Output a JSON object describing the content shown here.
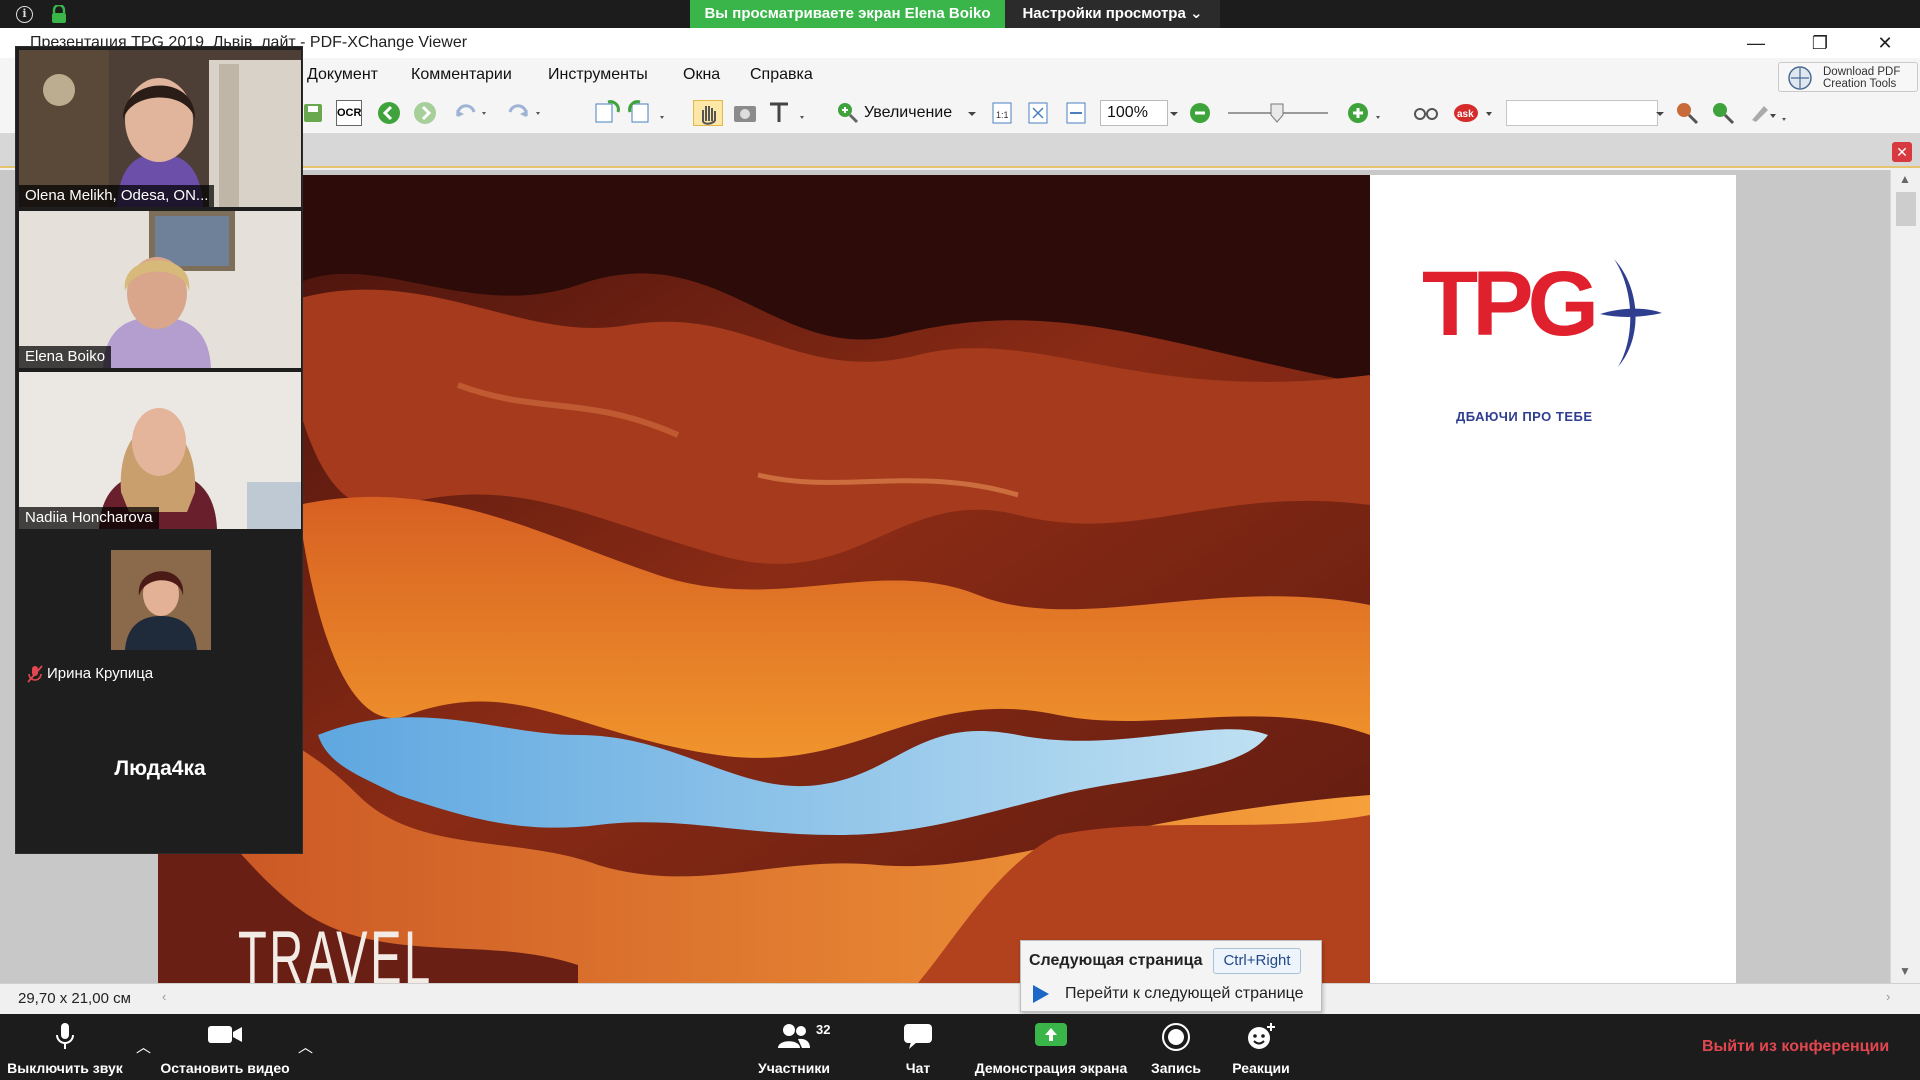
{
  "zoom_top": {
    "banner": "Вы просматриваете экран Elena Boiko",
    "view_options": "Настройки просмотра"
  },
  "window": {
    "title": "Презентация TPG 2019_Львів_лайт - PDF-XChange Viewer",
    "minimize": "—",
    "maximize": "❐",
    "close": "✕"
  },
  "menu": [
    "Документ",
    "Комментарии",
    "Инструменты",
    "Окна",
    "Справка"
  ],
  "download_tools": "Download PDF Creation Tools",
  "toolbar": {
    "ocr": "OCR",
    "zoom_label": "Увеличение",
    "zoom_value": "100%"
  },
  "slide": {
    "travel_text": "TRAVEL",
    "logo_letters": "TPG",
    "tagline": "ДБАЮЧИ ПРО ТЕБЕ"
  },
  "status": {
    "page_dims": "29,70 x 21,00 см"
  },
  "tooltip": {
    "title": "Следующая страница",
    "shortcut": "Ctrl+Right",
    "description": "Перейти к следующей странице"
  },
  "participants": [
    {
      "name": "Olena Melikh, Odesa, ON..."
    },
    {
      "name": "Elena Boiko"
    },
    {
      "name": "Nadiia Honcharova"
    },
    {
      "name": "Ирина Крупица"
    },
    {
      "name": "Люда4ка"
    }
  ],
  "zoom_bottom": {
    "mute": "Выключить звук",
    "stop_video": "Остановить видео",
    "participants": "Участники",
    "participants_count": "32",
    "chat": "Чат",
    "share": "Демонстрация экрана",
    "record": "Запись",
    "reactions": "Реакции",
    "leave": "Выйти из конференции"
  },
  "colors": {
    "zoom_bar": "#1c1c1c",
    "share_banner": "#39b54a",
    "leave": "#e2474f",
    "tpg_red": "#e0202c",
    "tpg_blue": "#2f3e8f",
    "active_speaker": "#5fc35a"
  }
}
